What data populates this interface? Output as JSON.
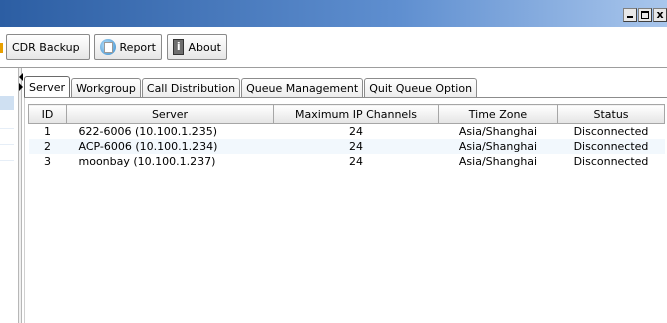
{
  "window": {
    "buttons": {
      "minimize": "_",
      "maximize": "□",
      "close": "x"
    }
  },
  "toolbar": {
    "buttons": [
      {
        "label": "CDR Backup",
        "icon": "cdr-backup-icon"
      },
      {
        "label": "Report",
        "icon": "report-icon"
      },
      {
        "label": "About",
        "icon": "about-icon"
      }
    ]
  },
  "tabs": [
    {
      "label": "Server",
      "active": true
    },
    {
      "label": "Workgroup",
      "active": false
    },
    {
      "label": "Call Distribution",
      "active": false
    },
    {
      "label": "Queue Management",
      "active": false
    },
    {
      "label": "Quit Queue Option",
      "active": false
    }
  ],
  "table": {
    "columns": [
      "ID",
      "Server",
      "Maximum IP Channels",
      "Time Zone",
      "Status"
    ],
    "rows": [
      {
        "id": "1",
        "server": "622-6006 (10.100.1.235)",
        "channels": "24",
        "timezone": "Asia/Shanghai",
        "status": "Disconnected"
      },
      {
        "id": "2",
        "server": "ACP-6006 (10.100.1.234)",
        "channels": "24",
        "timezone": "Asia/Shanghai",
        "status": "Disconnected"
      },
      {
        "id": "3",
        "server": "moonbay (10.100.1.237)",
        "channels": "24",
        "timezone": "Asia/Shanghai",
        "status": "Disconnected"
      }
    ]
  },
  "colors": {
    "titlebar_start": "#2c5ea3",
    "titlebar_end": "#a9c6ec",
    "row_alt": "#f2f8fd",
    "selected_strip": "#cfe0f2"
  }
}
